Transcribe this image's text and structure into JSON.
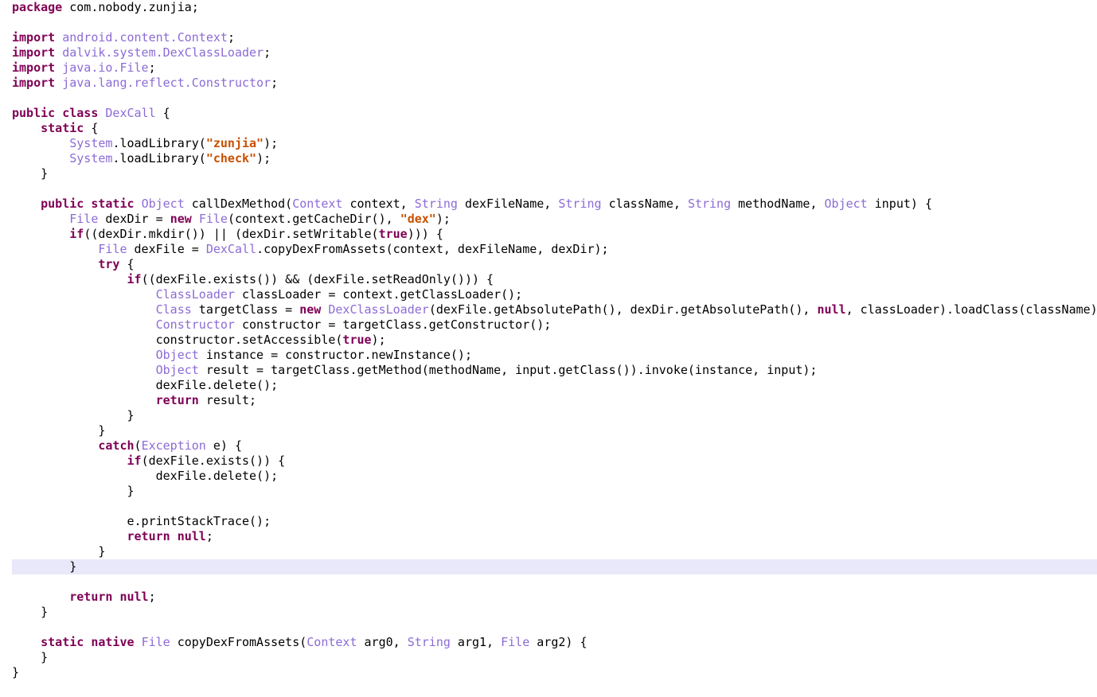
{
  "editor": {
    "language": "java",
    "current_line_index": 37,
    "colors": {
      "keyword": "#7f0055",
      "type": "#8c6bd6",
      "string": "#c85000",
      "plain": "#000000",
      "current_line": "#e8e8fa"
    },
    "lines": [
      [
        {
          "t": "kw",
          "v": "package"
        },
        {
          "t": "pl",
          "v": " com.nobody.zunjia;"
        }
      ],
      [],
      [
        {
          "t": "kw",
          "v": "import"
        },
        {
          "t": "pl",
          "v": " "
        },
        {
          "t": "ty",
          "v": "android.content.Context"
        },
        {
          "t": "pl",
          "v": ";"
        }
      ],
      [
        {
          "t": "kw",
          "v": "import"
        },
        {
          "t": "pl",
          "v": " "
        },
        {
          "t": "ty",
          "v": "dalvik.system.DexClassLoader"
        },
        {
          "t": "pl",
          "v": ";"
        }
      ],
      [
        {
          "t": "kw",
          "v": "import"
        },
        {
          "t": "pl",
          "v": " "
        },
        {
          "t": "ty",
          "v": "java.io.File"
        },
        {
          "t": "pl",
          "v": ";"
        }
      ],
      [
        {
          "t": "kw",
          "v": "import"
        },
        {
          "t": "pl",
          "v": " "
        },
        {
          "t": "ty",
          "v": "java.lang.reflect.Constructor"
        },
        {
          "t": "pl",
          "v": ";"
        }
      ],
      [],
      [
        {
          "t": "kw",
          "v": "public"
        },
        {
          "t": "pl",
          "v": " "
        },
        {
          "t": "kw",
          "v": "class"
        },
        {
          "t": "pl",
          "v": " "
        },
        {
          "t": "ty",
          "v": "DexCall"
        },
        {
          "t": "pl",
          "v": " {"
        }
      ],
      [
        {
          "t": "pl",
          "v": "    "
        },
        {
          "t": "kw",
          "v": "static"
        },
        {
          "t": "pl",
          "v": " {"
        }
      ],
      [
        {
          "t": "pl",
          "v": "        "
        },
        {
          "t": "ty",
          "v": "System"
        },
        {
          "t": "pl",
          "v": ".loadLibrary("
        },
        {
          "t": "str",
          "v": "\"zunjia\""
        },
        {
          "t": "pl",
          "v": ");"
        }
      ],
      [
        {
          "t": "pl",
          "v": "        "
        },
        {
          "t": "ty",
          "v": "System"
        },
        {
          "t": "pl",
          "v": ".loadLibrary("
        },
        {
          "t": "str",
          "v": "\"check\""
        },
        {
          "t": "pl",
          "v": ");"
        }
      ],
      [
        {
          "t": "pl",
          "v": "    }"
        }
      ],
      [],
      [
        {
          "t": "pl",
          "v": "    "
        },
        {
          "t": "kw",
          "v": "public"
        },
        {
          "t": "pl",
          "v": " "
        },
        {
          "t": "kw",
          "v": "static"
        },
        {
          "t": "pl",
          "v": " "
        },
        {
          "t": "ty",
          "v": "Object"
        },
        {
          "t": "pl",
          "v": " callDexMethod("
        },
        {
          "t": "ty",
          "v": "Context"
        },
        {
          "t": "pl",
          "v": " context, "
        },
        {
          "t": "ty",
          "v": "String"
        },
        {
          "t": "pl",
          "v": " dexFileName, "
        },
        {
          "t": "ty",
          "v": "String"
        },
        {
          "t": "pl",
          "v": " className, "
        },
        {
          "t": "ty",
          "v": "String"
        },
        {
          "t": "pl",
          "v": " methodName, "
        },
        {
          "t": "ty",
          "v": "Object"
        },
        {
          "t": "pl",
          "v": " input) {"
        }
      ],
      [
        {
          "t": "pl",
          "v": "        "
        },
        {
          "t": "ty",
          "v": "File"
        },
        {
          "t": "pl",
          "v": " dexDir = "
        },
        {
          "t": "kw",
          "v": "new"
        },
        {
          "t": "pl",
          "v": " "
        },
        {
          "t": "ty",
          "v": "File"
        },
        {
          "t": "pl",
          "v": "(context.getCacheDir(), "
        },
        {
          "t": "str",
          "v": "\"dex\""
        },
        {
          "t": "pl",
          "v": ");"
        }
      ],
      [
        {
          "t": "pl",
          "v": "        "
        },
        {
          "t": "kw",
          "v": "if"
        },
        {
          "t": "pl",
          "v": "((dexDir.mkdir()) || (dexDir.setWritable("
        },
        {
          "t": "kw",
          "v": "true"
        },
        {
          "t": "pl",
          "v": "))) {"
        }
      ],
      [
        {
          "t": "pl",
          "v": "            "
        },
        {
          "t": "ty",
          "v": "File"
        },
        {
          "t": "pl",
          "v": " dexFile = "
        },
        {
          "t": "ty",
          "v": "DexCall"
        },
        {
          "t": "pl",
          "v": ".copyDexFromAssets(context, dexFileName, dexDir);"
        }
      ],
      [
        {
          "t": "pl",
          "v": "            "
        },
        {
          "t": "kw",
          "v": "try"
        },
        {
          "t": "pl",
          "v": " {"
        }
      ],
      [
        {
          "t": "pl",
          "v": "                "
        },
        {
          "t": "kw",
          "v": "if"
        },
        {
          "t": "pl",
          "v": "((dexFile.exists()) && (dexFile.setReadOnly())) {"
        }
      ],
      [
        {
          "t": "pl",
          "v": "                    "
        },
        {
          "t": "ty",
          "v": "ClassLoader"
        },
        {
          "t": "pl",
          "v": " classLoader = context.getClassLoader();"
        }
      ],
      [
        {
          "t": "pl",
          "v": "                    "
        },
        {
          "t": "ty",
          "v": "Class"
        },
        {
          "t": "pl",
          "v": " targetClass = "
        },
        {
          "t": "kw",
          "v": "new"
        },
        {
          "t": "pl",
          "v": " "
        },
        {
          "t": "ty",
          "v": "DexClassLoader"
        },
        {
          "t": "pl",
          "v": "(dexFile.getAbsolutePath(), dexDir.getAbsolutePath(), "
        },
        {
          "t": "kw",
          "v": "null"
        },
        {
          "t": "pl",
          "v": ", classLoader).loadClass(className);"
        }
      ],
      [
        {
          "t": "pl",
          "v": "                    "
        },
        {
          "t": "ty",
          "v": "Constructor"
        },
        {
          "t": "pl",
          "v": " constructor = targetClass.getConstructor();"
        }
      ],
      [
        {
          "t": "pl",
          "v": "                    constructor.setAccessible("
        },
        {
          "t": "kw",
          "v": "true"
        },
        {
          "t": "pl",
          "v": ");"
        }
      ],
      [
        {
          "t": "pl",
          "v": "                    "
        },
        {
          "t": "ty",
          "v": "Object"
        },
        {
          "t": "pl",
          "v": " instance = constructor.newInstance();"
        }
      ],
      [
        {
          "t": "pl",
          "v": "                    "
        },
        {
          "t": "ty",
          "v": "Object"
        },
        {
          "t": "pl",
          "v": " result = targetClass.getMethod(methodName, input.getClass()).invoke(instance, input);"
        }
      ],
      [
        {
          "t": "pl",
          "v": "                    dexFile.delete();"
        }
      ],
      [
        {
          "t": "pl",
          "v": "                    "
        },
        {
          "t": "kw",
          "v": "return"
        },
        {
          "t": "pl",
          "v": " result;"
        }
      ],
      [
        {
          "t": "pl",
          "v": "                }"
        }
      ],
      [
        {
          "t": "pl",
          "v": "            }"
        }
      ],
      [
        {
          "t": "pl",
          "v": "            "
        },
        {
          "t": "kw",
          "v": "catch"
        },
        {
          "t": "pl",
          "v": "("
        },
        {
          "t": "ty",
          "v": "Exception"
        },
        {
          "t": "pl",
          "v": " e) {"
        }
      ],
      [
        {
          "t": "pl",
          "v": "                "
        },
        {
          "t": "kw",
          "v": "if"
        },
        {
          "t": "pl",
          "v": "(dexFile.exists()) {"
        }
      ],
      [
        {
          "t": "pl",
          "v": "                    dexFile.delete();"
        }
      ],
      [
        {
          "t": "pl",
          "v": "                }"
        }
      ],
      [],
      [
        {
          "t": "pl",
          "v": "                e.printStackTrace();"
        }
      ],
      [
        {
          "t": "pl",
          "v": "                "
        },
        {
          "t": "kw",
          "v": "return"
        },
        {
          "t": "pl",
          "v": " "
        },
        {
          "t": "kw",
          "v": "null"
        },
        {
          "t": "pl",
          "v": ";"
        }
      ],
      [
        {
          "t": "pl",
          "v": "            }"
        }
      ],
      [
        {
          "t": "pl",
          "v": "        }"
        }
      ],
      [],
      [
        {
          "t": "pl",
          "v": "        "
        },
        {
          "t": "kw",
          "v": "return"
        },
        {
          "t": "pl",
          "v": " "
        },
        {
          "t": "kw",
          "v": "null"
        },
        {
          "t": "pl",
          "v": ";"
        }
      ],
      [
        {
          "t": "pl",
          "v": "    }"
        }
      ],
      [],
      [
        {
          "t": "pl",
          "v": "    "
        },
        {
          "t": "kw",
          "v": "static"
        },
        {
          "t": "pl",
          "v": " "
        },
        {
          "t": "kw",
          "v": "native"
        },
        {
          "t": "pl",
          "v": " "
        },
        {
          "t": "ty",
          "v": "File"
        },
        {
          "t": "pl",
          "v": " copyDexFromAssets("
        },
        {
          "t": "ty",
          "v": "Context"
        },
        {
          "t": "pl",
          "v": " arg0, "
        },
        {
          "t": "ty",
          "v": "String"
        },
        {
          "t": "pl",
          "v": " arg1, "
        },
        {
          "t": "ty",
          "v": "File"
        },
        {
          "t": "pl",
          "v": " arg2) {"
        }
      ],
      [
        {
          "t": "pl",
          "v": "    }"
        }
      ],
      [
        {
          "t": "pl",
          "v": "}"
        }
      ]
    ]
  }
}
